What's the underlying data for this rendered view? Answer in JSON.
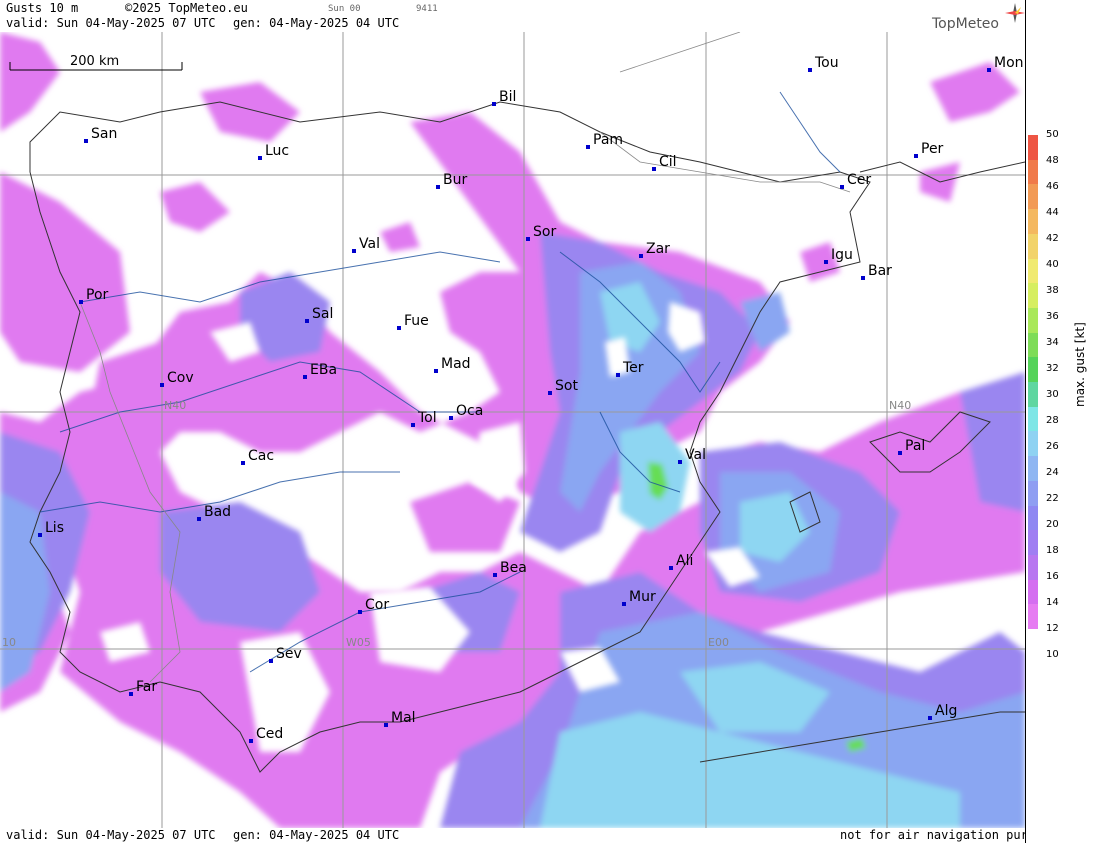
{
  "header": {
    "title": "Gusts 10 m",
    "copyright": "©2025 TopMeteo.eu",
    "run": "Sun 00",
    "code": "9411",
    "valid": "valid:  Sun  04-May-2025  07 UTC",
    "gen": "gen: 04-May-2025 04 UTC",
    "logo": "TopMeteo"
  },
  "footer": {
    "valid": "valid:  Sun  04-May-2025  07 UTC",
    "gen": "gen: 04-May-2025 04 UTC",
    "notice": "not for air navigation purposes"
  },
  "scale_bar": {
    "label": "200 km"
  },
  "grid_labels": {
    "n40_left": "N40",
    "n40_right": "N40",
    "w10": "10",
    "w05": "W05",
    "e00": "E00"
  },
  "cities": [
    {
      "name": "Tou"
    },
    {
      "name": "Mon"
    },
    {
      "name": "Bil"
    },
    {
      "name": "San"
    },
    {
      "name": "Pam"
    },
    {
      "name": "Luc"
    },
    {
      "name": "Cil"
    },
    {
      "name": "Per"
    },
    {
      "name": "Bur"
    },
    {
      "name": "Cer"
    },
    {
      "name": "Sor"
    },
    {
      "name": "Val"
    },
    {
      "name": "Zar"
    },
    {
      "name": "Igu"
    },
    {
      "name": "Bar"
    },
    {
      "name": "Por"
    },
    {
      "name": "Sal"
    },
    {
      "name": "Fue"
    },
    {
      "name": "Mad"
    },
    {
      "name": "EBa"
    },
    {
      "name": "Ter"
    },
    {
      "name": "Cov"
    },
    {
      "name": "Sot"
    },
    {
      "name": "Tol"
    },
    {
      "name": "Oca"
    },
    {
      "name": "Pal"
    },
    {
      "name": "Cac"
    },
    {
      "name": "Val"
    },
    {
      "name": "Bad"
    },
    {
      "name": "Lis"
    },
    {
      "name": "Ali"
    },
    {
      "name": "Bea"
    },
    {
      "name": "Mur"
    },
    {
      "name": "Cor"
    },
    {
      "name": "Sev"
    },
    {
      "name": "Far"
    },
    {
      "name": "Alg"
    },
    {
      "name": "Mal"
    },
    {
      "name": "Ced"
    }
  ],
  "legend": {
    "title": "max. gust  [kt]",
    "ticks": [
      50,
      48,
      46,
      44,
      42,
      40,
      38,
      36,
      34,
      32,
      30,
      28,
      26,
      24,
      22,
      20,
      18,
      16,
      14,
      12,
      10
    ],
    "colors": [
      "#ee5544",
      "#f07a4a",
      "#f29a55",
      "#f4b860",
      "#f2d36a",
      "#f0ea70",
      "#d6ee60",
      "#a9e85a",
      "#7edc58",
      "#55d35a",
      "#5fd6a0",
      "#7ee6e6",
      "#8fd2f2",
      "#8fb6f2",
      "#8f9ef2",
      "#8f88f2",
      "#a07ef2",
      "#b877f0",
      "#d46ef0",
      "#e67cf2"
    ]
  },
  "colors": {
    "magenta": "#e07af0",
    "violet": "#9a86f0",
    "blue": "#8aa6f2",
    "lightblue": "#8ed6f2",
    "green": "#66dd55",
    "city_dot": "#0000cc"
  }
}
